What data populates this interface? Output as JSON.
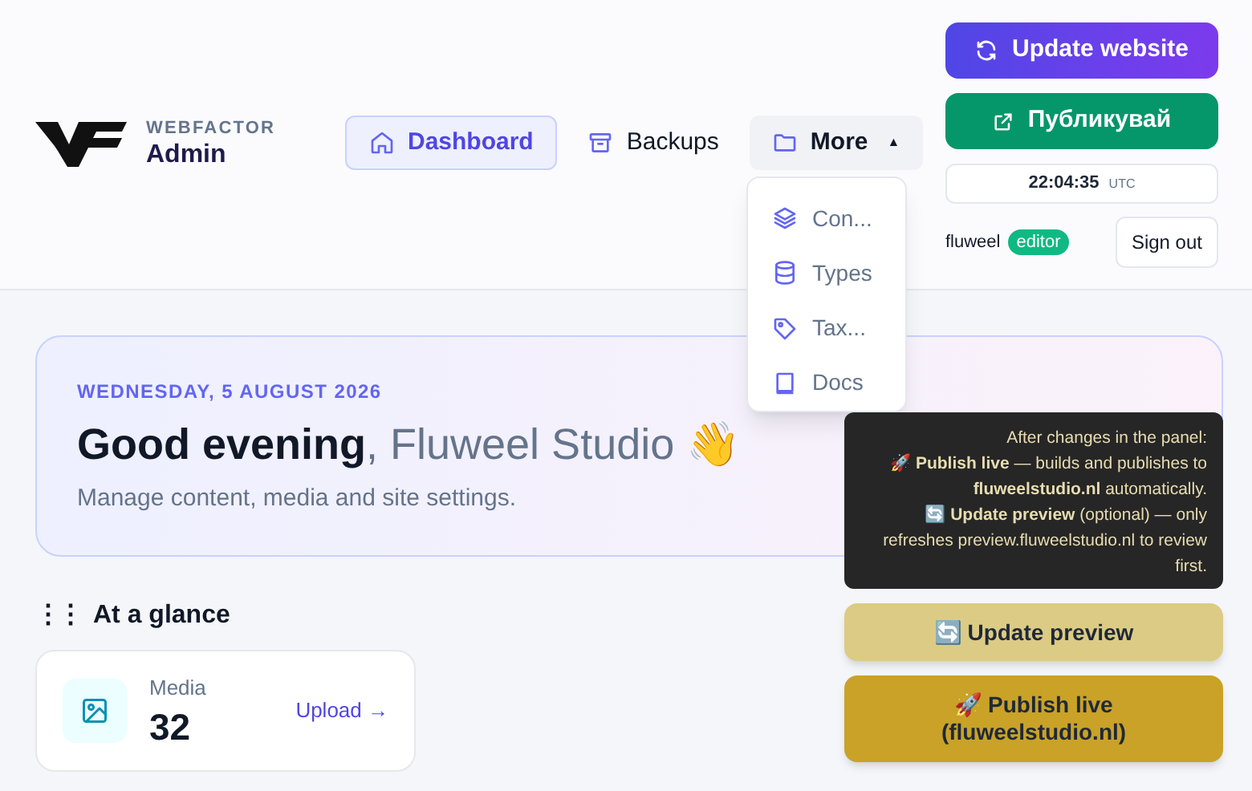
{
  "brand": {
    "kicker": "WEBFACTOR",
    "title": "Admin"
  },
  "nav": [
    {
      "label": "Dashboard",
      "selected": true
    },
    {
      "label": "Backups",
      "selected": false
    },
    {
      "label": "More",
      "selected": false,
      "caret": "▲",
      "expanded": true
    }
  ],
  "more_menu": [
    {
      "label": "Con..."
    },
    {
      "label": "Types"
    },
    {
      "label": "Tax..."
    },
    {
      "label": "Docs"
    }
  ],
  "actions": [
    {
      "label": "Update website",
      "kind": "update"
    },
    {
      "label": "Публикувай",
      "kind": "publish"
    }
  ],
  "clock": {
    "time": "22:04:35",
    "zone": "UTC"
  },
  "user": {
    "name": "fluweel",
    "role": "editor",
    "sign_out": "Sign out"
  },
  "hero": {
    "date": "WEDNESDAY, 5 AUGUST 2026",
    "greeting": "Good evening",
    "name": ", Fluweel Studio 👋",
    "subtitle": "Manage content, media and site settings."
  },
  "section_title": {
    "handle": "⋮⋮",
    "label": "At a glance"
  },
  "stats": [
    {
      "label": "Media",
      "value": "32",
      "link": "Upload →"
    }
  ],
  "tooltip": [
    "After changes in the panel:",
    "🚀 **Publish live** — builds and publishes to **fluweelstudio.nl** automatically.",
    "🔄 **Update preview** (optional) — only refreshes preview.fluweelstudio.nl to review first."
  ],
  "deploy_buttons": [
    {
      "label": "🔄 Update preview",
      "kind": "preview"
    },
    {
      "label": "🚀 Publish live (fluweelstudio.nl)",
      "kind": "live"
    }
  ]
}
